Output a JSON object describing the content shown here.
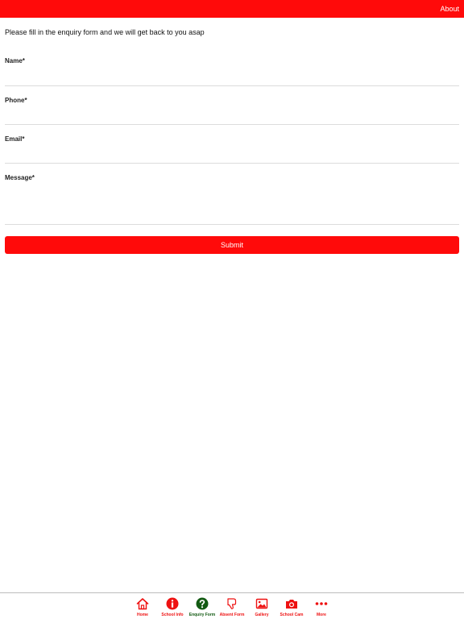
{
  "header": {
    "about_label": "About"
  },
  "intro_text": "Please fill in the enquiry form and we will get back to you asap",
  "form": {
    "name_label": "Name*",
    "name_value": "",
    "phone_label": "Phone*",
    "phone_value": "",
    "email_label": "Email*",
    "email_value": "",
    "message_label": "Message*",
    "message_value": "",
    "submit_label": "Submit"
  },
  "tabs": [
    {
      "label": "Home",
      "icon": "home-icon",
      "active": false
    },
    {
      "label": "School Info",
      "icon": "info-icon",
      "active": false
    },
    {
      "label": "Enquiry Form",
      "icon": "question-icon",
      "active": true
    },
    {
      "label": "Absent Form",
      "icon": "thumbs-down-icon",
      "active": false
    },
    {
      "label": "Gallery",
      "icon": "gallery-icon",
      "active": false
    },
    {
      "label": "School Cam",
      "icon": "camera-icon",
      "active": false
    },
    {
      "label": "More",
      "icon": "more-icon",
      "active": false
    }
  ],
  "colors": {
    "brand_red": "#ff0a0a",
    "active_green": "#125a12"
  }
}
